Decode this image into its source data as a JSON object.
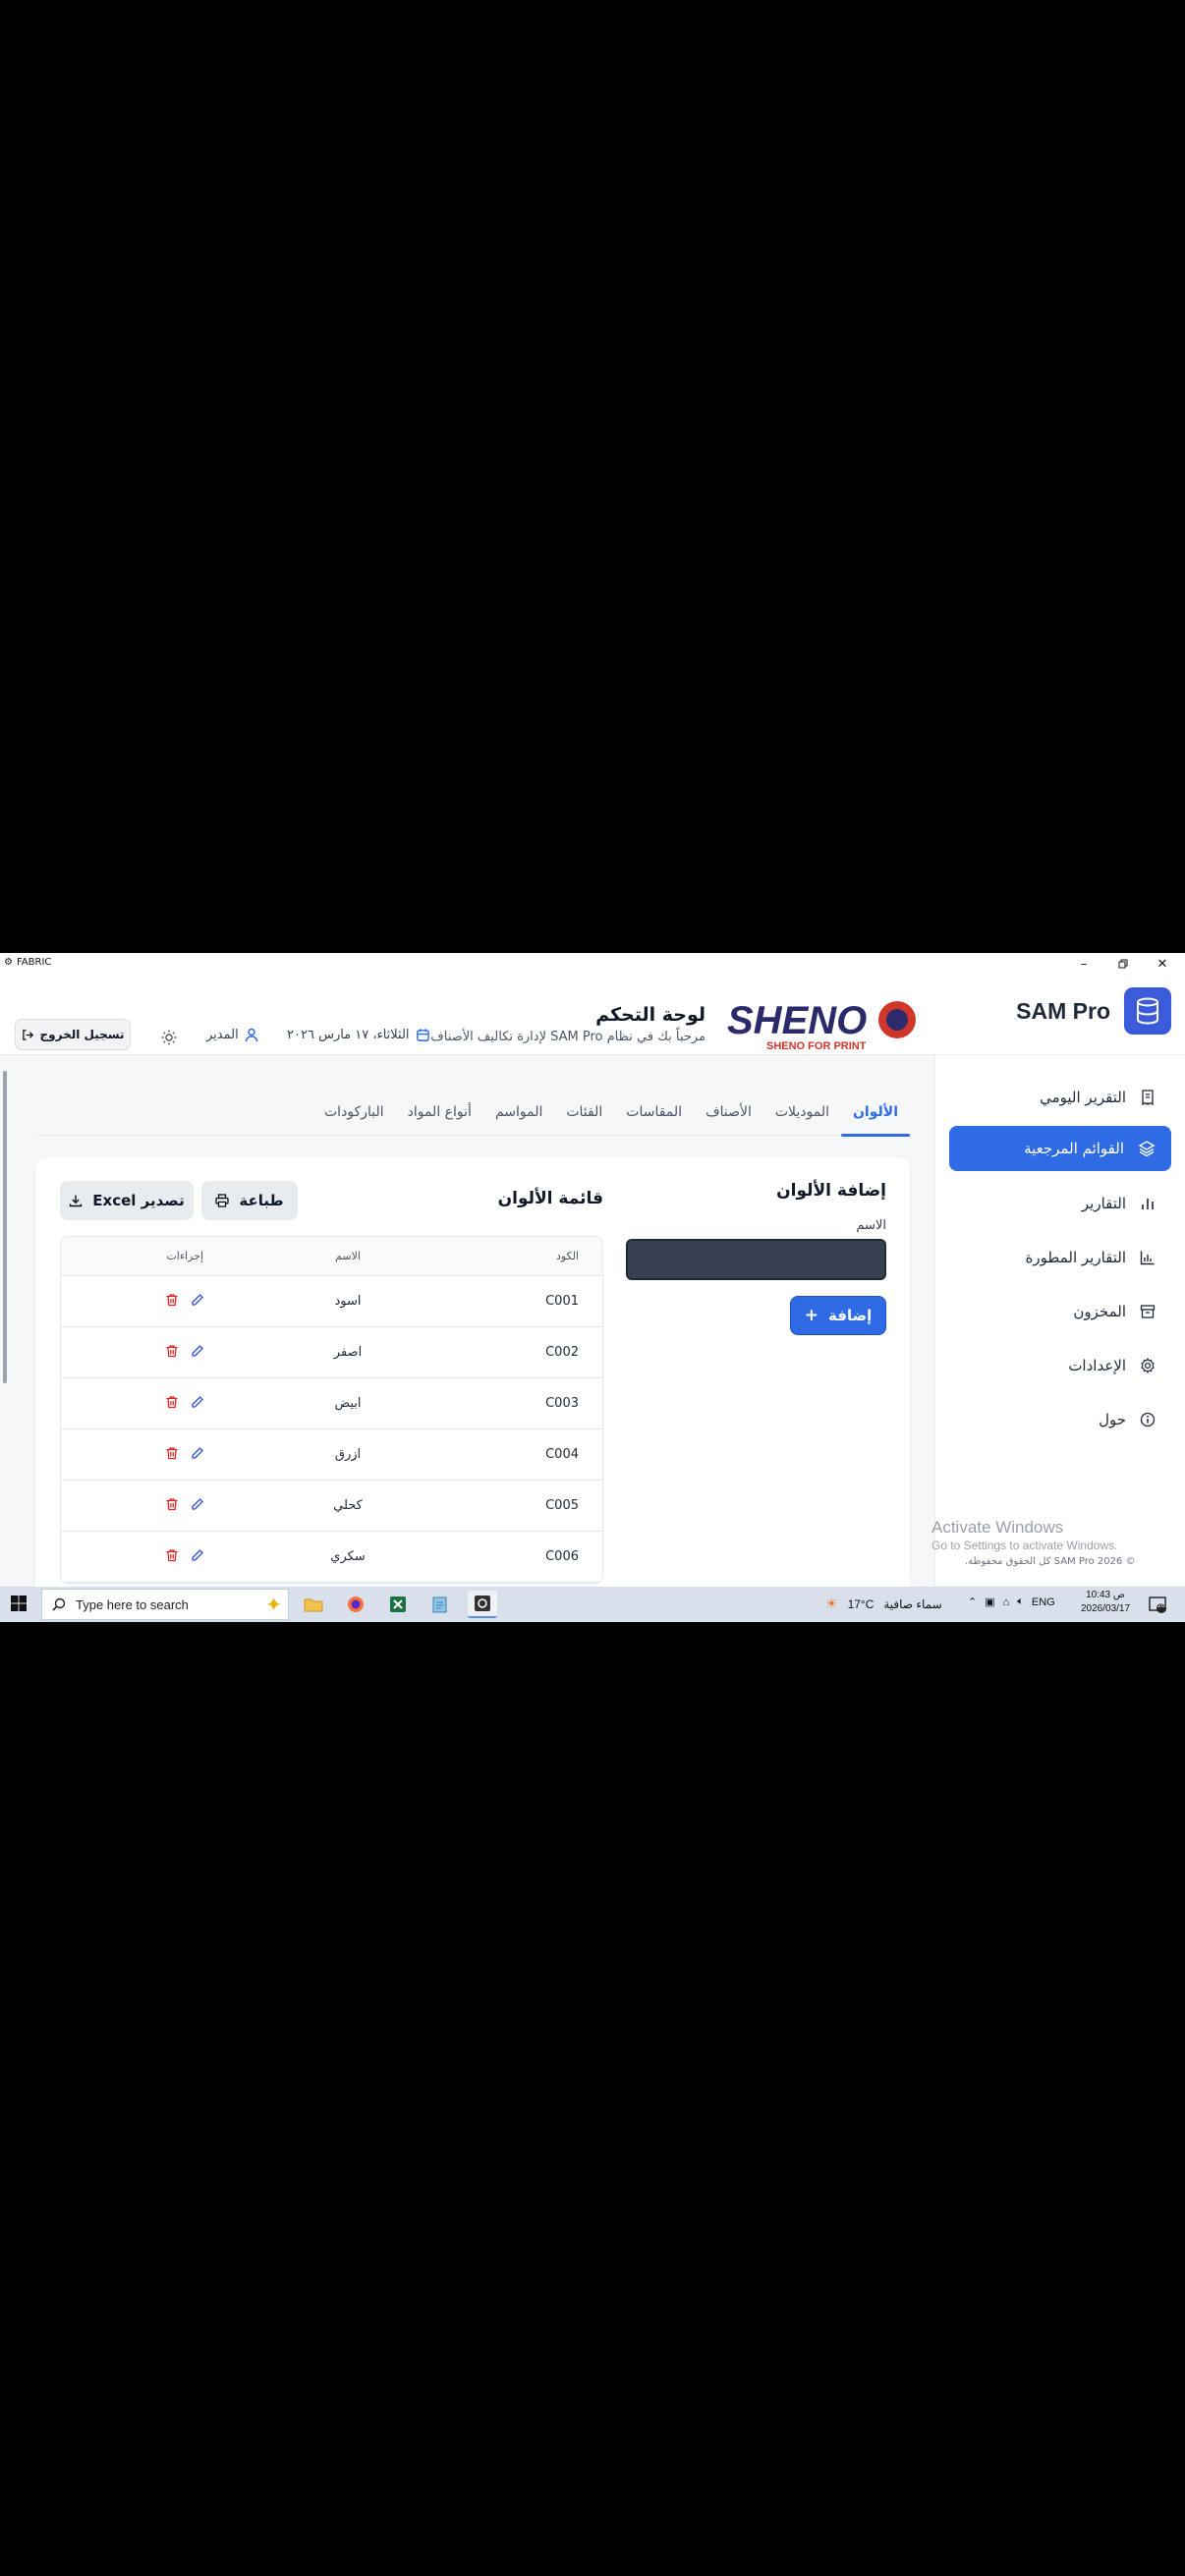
{
  "window": {
    "title": "FABRIC"
  },
  "brand": {
    "name": "SAM Pro"
  },
  "logo": {
    "text": "SHENO",
    "tagline": "SHENO FOR PRINT"
  },
  "header": {
    "title": "لوحة التحكم",
    "subtitle": "مرحباً بك في نظام SAM Pro لإدارة تكاليف الأصناف",
    "date": "الثلاثاء، ١٧ مارس ٢٠٢٦",
    "user": "المدير",
    "logout_label": "تسجيل الخروج"
  },
  "sidebar": {
    "items": [
      {
        "label": "التقرير اليومي",
        "icon": "receipt-icon",
        "active": false
      },
      {
        "label": "القوائم المرجعية",
        "icon": "layers-icon",
        "active": true
      },
      {
        "label": "التقارير",
        "icon": "bar-chart-icon",
        "active": false
      },
      {
        "label": "التقارير المطورة",
        "icon": "chart-icon",
        "active": false
      },
      {
        "label": "المخزون",
        "icon": "archive-icon",
        "active": false
      },
      {
        "label": "الإعدادات",
        "icon": "gear-icon",
        "active": false
      },
      {
        "label": "حول",
        "icon": "info-icon",
        "active": false
      }
    ]
  },
  "tabs": [
    {
      "label": "الألوان",
      "active": true
    },
    {
      "label": "الموديلات"
    },
    {
      "label": "الأصناف"
    },
    {
      "label": "المقاسات"
    },
    {
      "label": "الفئات"
    },
    {
      "label": "المواسم"
    },
    {
      "label": "أنواع المواد"
    },
    {
      "label": "الباركودات"
    }
  ],
  "add_panel": {
    "title": "إضافة الألوان",
    "name_label": "الاسم",
    "name_value": "",
    "add_label": "إضافة"
  },
  "list_panel": {
    "title": "قائمة الألوان",
    "print_label": "طباعة",
    "export_label": "تصدير Excel",
    "columns": {
      "code": "الكود",
      "name": "الاسم",
      "actions": "إجراءات"
    },
    "rows": [
      {
        "code": "C001",
        "name": "اسود"
      },
      {
        "code": "C002",
        "name": "اصفر"
      },
      {
        "code": "C003",
        "name": "ابيض"
      },
      {
        "code": "C004",
        "name": "ازرق"
      },
      {
        "code": "C005",
        "name": "كحلي"
      },
      {
        "code": "C006",
        "name": "سكري"
      }
    ]
  },
  "watermark": {
    "activate_title": "Activate Windows",
    "activate_sub": "Go to Settings to activate Windows."
  },
  "footer": {
    "copyright": "© SAM Pro 2026 كل الحقوق محفوظة."
  },
  "taskbar": {
    "search_placeholder": "Type here to search",
    "weather_temp": "17°C",
    "weather_text": "سماء صافية",
    "lang": "ENG",
    "time": "10:43 ص",
    "date": "2026/03/17",
    "notif_count": "26"
  },
  "colors": {
    "accent": "#2f6be5",
    "brand": "#3b5bdb",
    "logo_navy": "#2b2a6b",
    "logo_red": "#d0362a",
    "delete": "#dc2626",
    "edit": "#2f4fd0"
  }
}
